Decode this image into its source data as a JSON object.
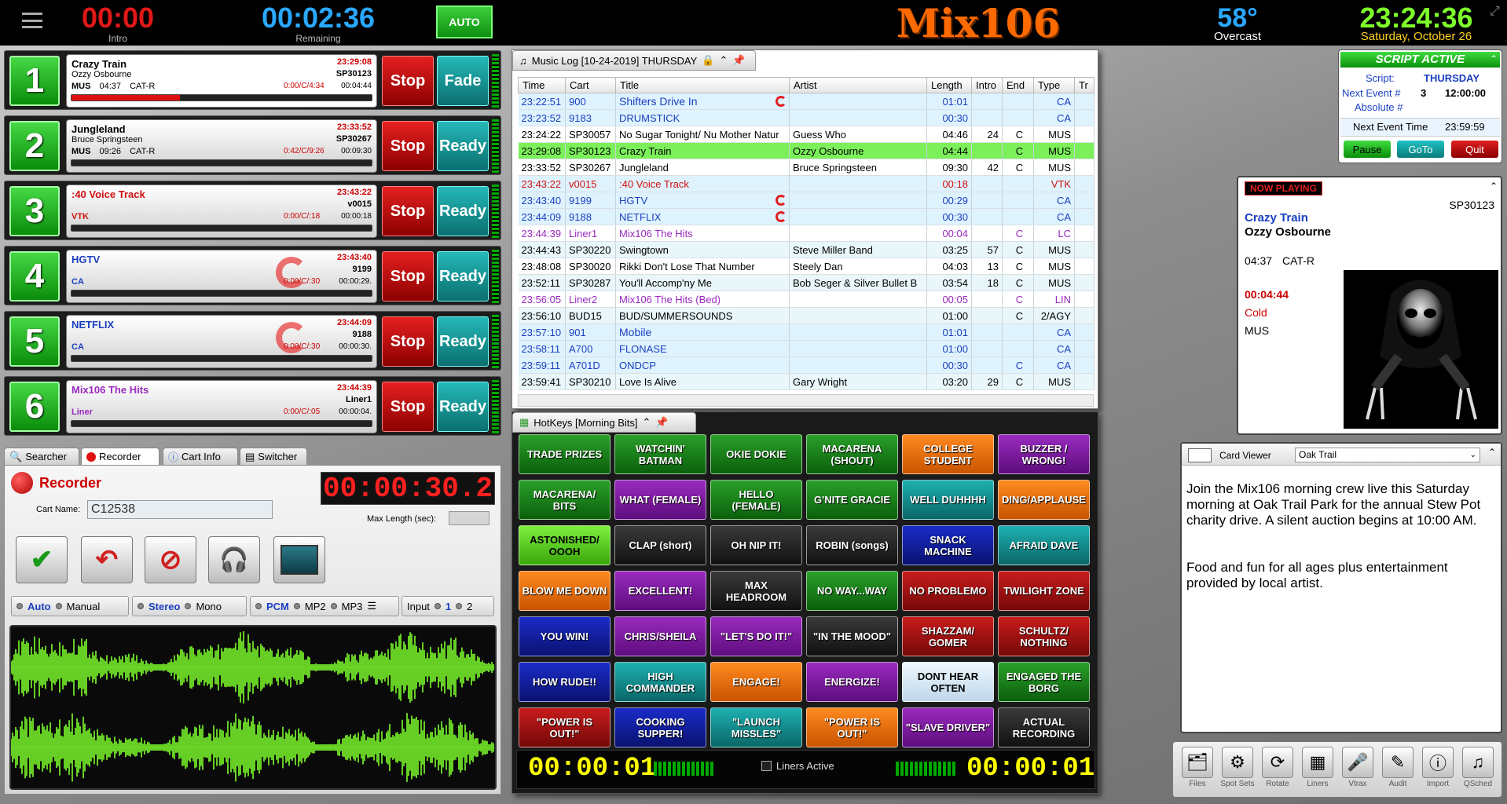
{
  "topbar": {
    "intro_time": "00:00",
    "intro_label": "Intro",
    "remaining_time": "00:02:36",
    "remaining_label": "Remaining",
    "auto_label": "AUTO",
    "logo": "Mix106",
    "temperature": "58°",
    "weather": "Overcast",
    "clock": "23:24:36",
    "date": "Saturday, October 26"
  },
  "decks": [
    {
      "num": "1",
      "title": "Crazy Train",
      "artist": "Ozzy Osbourne",
      "type": "MUS",
      "len": "04:37",
      "cat": "CAT-R",
      "time": "23:29:08",
      "cart": "SP30123",
      "count": "0:00/C/4:34",
      "remain": "00:04:44",
      "progress": 0.36,
      "stop": "Stop",
      "action": "Fade"
    },
    {
      "num": "2",
      "title": "Jungleland",
      "artist": "Bruce Springsteen",
      "type": "MUS",
      "len": "09:26",
      "cat": "CAT-R",
      "time": "23:33:52",
      "cart": "SP30267",
      "count": "0:42/C/9:26",
      "remain": "00:09:30",
      "progress": 0,
      "stop": "Stop",
      "action": "Ready"
    },
    {
      "num": "3",
      "title": ":40 Voice Track",
      "artist": "",
      "type": "VTK",
      "len": "",
      "cat": "",
      "time": "23:43:22",
      "cart": "v0015",
      "count": "0:00/C/:18",
      "remain": "00:00:18",
      "progress": 0,
      "stop": "Stop",
      "action": "Ready"
    },
    {
      "num": "4",
      "title": "HGTV",
      "artist": "",
      "type": "CA",
      "len": "",
      "cat": "",
      "time": "23:43:40",
      "cart": "9199",
      "count": "0:00/C/:30",
      "remain": "00:00:29.",
      "progress": 0,
      "stop": "Stop",
      "action": "Ready"
    },
    {
      "num": "5",
      "title": "NETFLIX",
      "artist": "",
      "type": "CA",
      "len": "",
      "cat": "",
      "time": "23:44:09",
      "cart": "9188",
      "count": "0:00/C/:30",
      "remain": "00:00:30.",
      "progress": 0,
      "stop": "Stop",
      "action": "Ready"
    },
    {
      "num": "6",
      "title": "Mix106 The Hits",
      "artist": "",
      "type": "Liner",
      "len": "",
      "cat": "",
      "time": "23:44:39",
      "cart": "Liner1",
      "count": "0:00/C/:05",
      "remain": "00:00:04.",
      "progress": 0,
      "stop": "Stop",
      "action": "Ready"
    }
  ],
  "tabs": [
    "Searcher",
    "Recorder",
    "Cart Info",
    "Switcher"
  ],
  "recorder": {
    "title": "Recorder",
    "timer": "00:00:30.2",
    "cart_name_label": "Cart Name:",
    "cart_name": "C12538",
    "max_length_label": "Max Length (sec):",
    "opt_auto": "Auto",
    "opt_manual": "Manual",
    "opt_stereo": "Stereo",
    "opt_mono": "Mono",
    "opt_pcm": "PCM",
    "opt_mp2": "MP2",
    "opt_mp3": "MP3",
    "input_label": "Input",
    "input_1": "1",
    "input_2": "2"
  },
  "musiclog": {
    "title": "Music Log [10-24-2019] THURSDAY",
    "columns": [
      "Time",
      "Cart",
      "Title",
      "Artist",
      "Length",
      "Intro",
      "End",
      "Type",
      "Tr"
    ],
    "rows": [
      {
        "time": "23:22:51",
        "cart": "900",
        "title": "Shifters Drive In",
        "artist": "",
        "len": "01:01",
        "intro": "",
        "end": "",
        "type": "CA",
        "style": "ca",
        "q": true
      },
      {
        "time": "23:23:52",
        "cart": "9183",
        "title": "DRUMSTICK",
        "artist": "",
        "len": "00:30",
        "intro": "",
        "end": "",
        "type": "CA",
        "style": "ca",
        "q": false
      },
      {
        "time": "23:24:22",
        "cart": "SP30057",
        "title": "No Sugar Tonight/ Nu Mother Natur",
        "artist": "Guess Who",
        "len": "04:46",
        "intro": "24",
        "end": "C",
        "type": "MUS",
        "style": "mus",
        "q": false
      },
      {
        "time": "23:29:08",
        "cart": "SP30123",
        "title": "Crazy Train",
        "artist": "Ozzy Osbourne",
        "len": "04:44",
        "intro": "",
        "end": "C",
        "type": "MUS",
        "style": "playing",
        "q": false
      },
      {
        "time": "23:33:52",
        "cart": "SP30267",
        "title": "Jungleland",
        "artist": "Bruce Springsteen",
        "len": "09:30",
        "intro": "42",
        "end": "C",
        "type": "MUS",
        "style": "mus",
        "q": false
      },
      {
        "time": "23:43:22",
        "cart": "v0015",
        "title": ":40 Voice Track",
        "artist": "",
        "len": "00:18",
        "intro": "",
        "end": "",
        "type": "VTK",
        "style": "vtk",
        "q": false
      },
      {
        "time": "23:43:40",
        "cart": "9199",
        "title": "HGTV",
        "artist": "",
        "len": "00:29",
        "intro": "",
        "end": "",
        "type": "CA",
        "style": "ca",
        "q": true
      },
      {
        "time": "23:44:09",
        "cart": "9188",
        "title": "NETFLIX",
        "artist": "",
        "len": "00:30",
        "intro": "",
        "end": "",
        "type": "CA",
        "style": "ca",
        "q": true
      },
      {
        "time": "23:44:39",
        "cart": "Liner1",
        "title": "Mix106 The Hits",
        "artist": "",
        "len": "00:04",
        "intro": "",
        "end": "C",
        "type": "LC",
        "style": "liner",
        "q": false
      },
      {
        "time": "23:44:43",
        "cart": "SP30220",
        "title": "Swingtown",
        "artist": "Steve Miller Band",
        "len": "03:25",
        "intro": "57",
        "end": "C",
        "type": "MUS",
        "style": "mus",
        "q": false
      },
      {
        "time": "23:48:08",
        "cart": "SP30020",
        "title": "Rikki Don't Lose That Number",
        "artist": "Steely Dan",
        "len": "04:03",
        "intro": "13",
        "end": "C",
        "type": "MUS",
        "style": "mus",
        "q": false
      },
      {
        "time": "23:52:11",
        "cart": "SP30287",
        "title": "You'll Accomp'ny Me",
        "artist": "Bob Seger & Silver Bullet B",
        "len": "03:54",
        "intro": "18",
        "end": "C",
        "type": "MUS",
        "style": "mus",
        "q": false
      },
      {
        "time": "23:56:05",
        "cart": "Liner2",
        "title": "Mix106 The Hits (Bed)",
        "artist": "",
        "len": "00:05",
        "intro": "",
        "end": "C",
        "type": "LIN",
        "style": "liner",
        "q": false
      },
      {
        "time": "23:56:10",
        "cart": "BUD15",
        "title": "BUD/SUMMERSOUNDS",
        "artist": "",
        "len": "01:00",
        "intro": "",
        "end": "C",
        "type": "2/AGY",
        "style": "mus",
        "q": false
      },
      {
        "time": "23:57:10",
        "cart": "901",
        "title": "Mobile",
        "artist": "",
        "len": "01:01",
        "intro": "",
        "end": "",
        "type": "CA",
        "style": "ca",
        "q": false
      },
      {
        "time": "23:58:11",
        "cart": "A700",
        "title": "FLONASE",
        "artist": "",
        "len": "01:00",
        "intro": "",
        "end": "",
        "type": "CA",
        "style": "ca",
        "q": false
      },
      {
        "time": "23:59:11",
        "cart": "A701D",
        "title": "ONDCP",
        "artist": "",
        "len": "00:30",
        "intro": "",
        "end": "C",
        "type": "CA",
        "style": "ca",
        "q": false
      },
      {
        "time": "23:59:41",
        "cart": "SP30210",
        "title": "Love Is Alive",
        "artist": "Gary Wright",
        "len": "03:20",
        "intro": "29",
        "end": "C",
        "type": "MUS",
        "style": "mus",
        "q": false
      }
    ]
  },
  "hotkeys": {
    "title": "HotKeys [Morning Bits]",
    "buttons": [
      {
        "label": "TRADE PRIZES",
        "color": "green"
      },
      {
        "label": "WATCHIN' BATMAN",
        "color": "green"
      },
      {
        "label": "OKIE DOKIE",
        "color": "green"
      },
      {
        "label": "MACARENA (SHOUT)",
        "color": "green"
      },
      {
        "label": "COLLEGE STUDENT",
        "color": "orange"
      },
      {
        "label": "BUZZER / WRONG!",
        "color": "purple"
      },
      {
        "label": "MACARENA/ BITS",
        "color": "green"
      },
      {
        "label": "WHAT (FEMALE)",
        "color": "purple"
      },
      {
        "label": "HELLO (FEMALE)",
        "color": "green"
      },
      {
        "label": "G'NITE GRACIE",
        "color": "green"
      },
      {
        "label": "WELL DUHHHH",
        "color": "teal"
      },
      {
        "label": "DING/APPLAUSE",
        "color": "orange"
      },
      {
        "label": "ASTONISHED/ OOOH",
        "color": "lime"
      },
      {
        "label": "CLAP (short)",
        "color": "black"
      },
      {
        "label": "OH NIP IT!",
        "color": "black"
      },
      {
        "label": "ROBIN (songs)",
        "color": "black"
      },
      {
        "label": "SNACK MACHINE",
        "color": "blue"
      },
      {
        "label": "AFRAID DAVE",
        "color": "teal"
      },
      {
        "label": "BLOW ME DOWN",
        "color": "orange"
      },
      {
        "label": "EXCELLENT!",
        "color": "purple"
      },
      {
        "label": "MAX HEADROOM",
        "color": "black"
      },
      {
        "label": "NO WAY...WAY",
        "color": "green"
      },
      {
        "label": "NO PROBLEMO",
        "color": "red"
      },
      {
        "label": "TWILIGHT ZONE",
        "color": "red"
      },
      {
        "label": "YOU WIN!",
        "color": "blue"
      },
      {
        "label": "CHRIS/SHEILA",
        "color": "purple"
      },
      {
        "label": "\"LET'S DO IT!\"",
        "color": "purple"
      },
      {
        "label": "\"IN THE MOOD\"",
        "color": "black"
      },
      {
        "label": "SHAZZAM/ GOMER",
        "color": "red"
      },
      {
        "label": "SCHULTZ/ NOTHING",
        "color": "red"
      },
      {
        "label": "HOW RUDE!!",
        "color": "blue"
      },
      {
        "label": "HIGH COMMANDER",
        "color": "teal"
      },
      {
        "label": "ENGAGE!",
        "color": "orange"
      },
      {
        "label": "ENERGIZE!",
        "color": "purple"
      },
      {
        "label": "DONT HEAR OFTEN",
        "color": "white"
      },
      {
        "label": "ENGAGED THE BORG",
        "color": "green"
      },
      {
        "label": "\"POWER IS OUT!\"",
        "color": "red"
      },
      {
        "label": "COOKING SUPPER!",
        "color": "blue"
      },
      {
        "label": "\"LAUNCH MISSLES\"",
        "color": "teal"
      },
      {
        "label": "\"POWER IS OUT!\"",
        "color": "orange"
      },
      {
        "label": "\"SLAVE DRIVER\"",
        "color": "purple"
      },
      {
        "label": "ACTUAL RECORDING",
        "color": "black"
      }
    ],
    "timer_left": "00:00:01",
    "timer_right": "00:00:01",
    "liners_label": "Liners Active"
  },
  "script": {
    "header": "SCRIPT ACTIVE",
    "script_label": "Script:",
    "script_value": "THURSDAY",
    "next_event_label": "Next Event #",
    "next_event_num": "3",
    "next_event_time": "12:00:00",
    "absolute_label": "Absolute #",
    "next_event_time_label": "Next Event Time",
    "next_event_time_value": "23:59:59",
    "pause": "Pause",
    "goto": "GoTo",
    "quit": "Quit"
  },
  "nowplaying": {
    "header": "NOW PLAYING",
    "cart": "SP30123",
    "title": "Crazy Train",
    "artist": "Ozzy Osbourne",
    "len": "04:37",
    "cat": "CAT-R",
    "remain": "00:04:44",
    "ending": "Cold",
    "type": "MUS"
  },
  "cardviewer": {
    "label": "Card Viewer",
    "selected": "Oak Trail",
    "para1": "Join the Mix106 morning crew live this Saturday morning  at Oak Trail Park for the annual Stew Pot charity drive. A silent auction begins at 10:00 AM.",
    "para2": "Food and fun for all ages plus entertainment provided by local artist."
  },
  "toolbar": [
    {
      "label": "Files",
      "icon": "🗂"
    },
    {
      "label": "Spot Sets",
      "icon": "⚙"
    },
    {
      "label": "Rotate",
      "icon": "⟳"
    },
    {
      "label": "Liners",
      "icon": "▦"
    },
    {
      "label": "Vtrax",
      "icon": "🎤"
    },
    {
      "label": "Audit",
      "icon": "✎"
    },
    {
      "label": "Import",
      "icon": "ⓘ"
    },
    {
      "label": "QSched",
      "icon": "♫"
    }
  ]
}
